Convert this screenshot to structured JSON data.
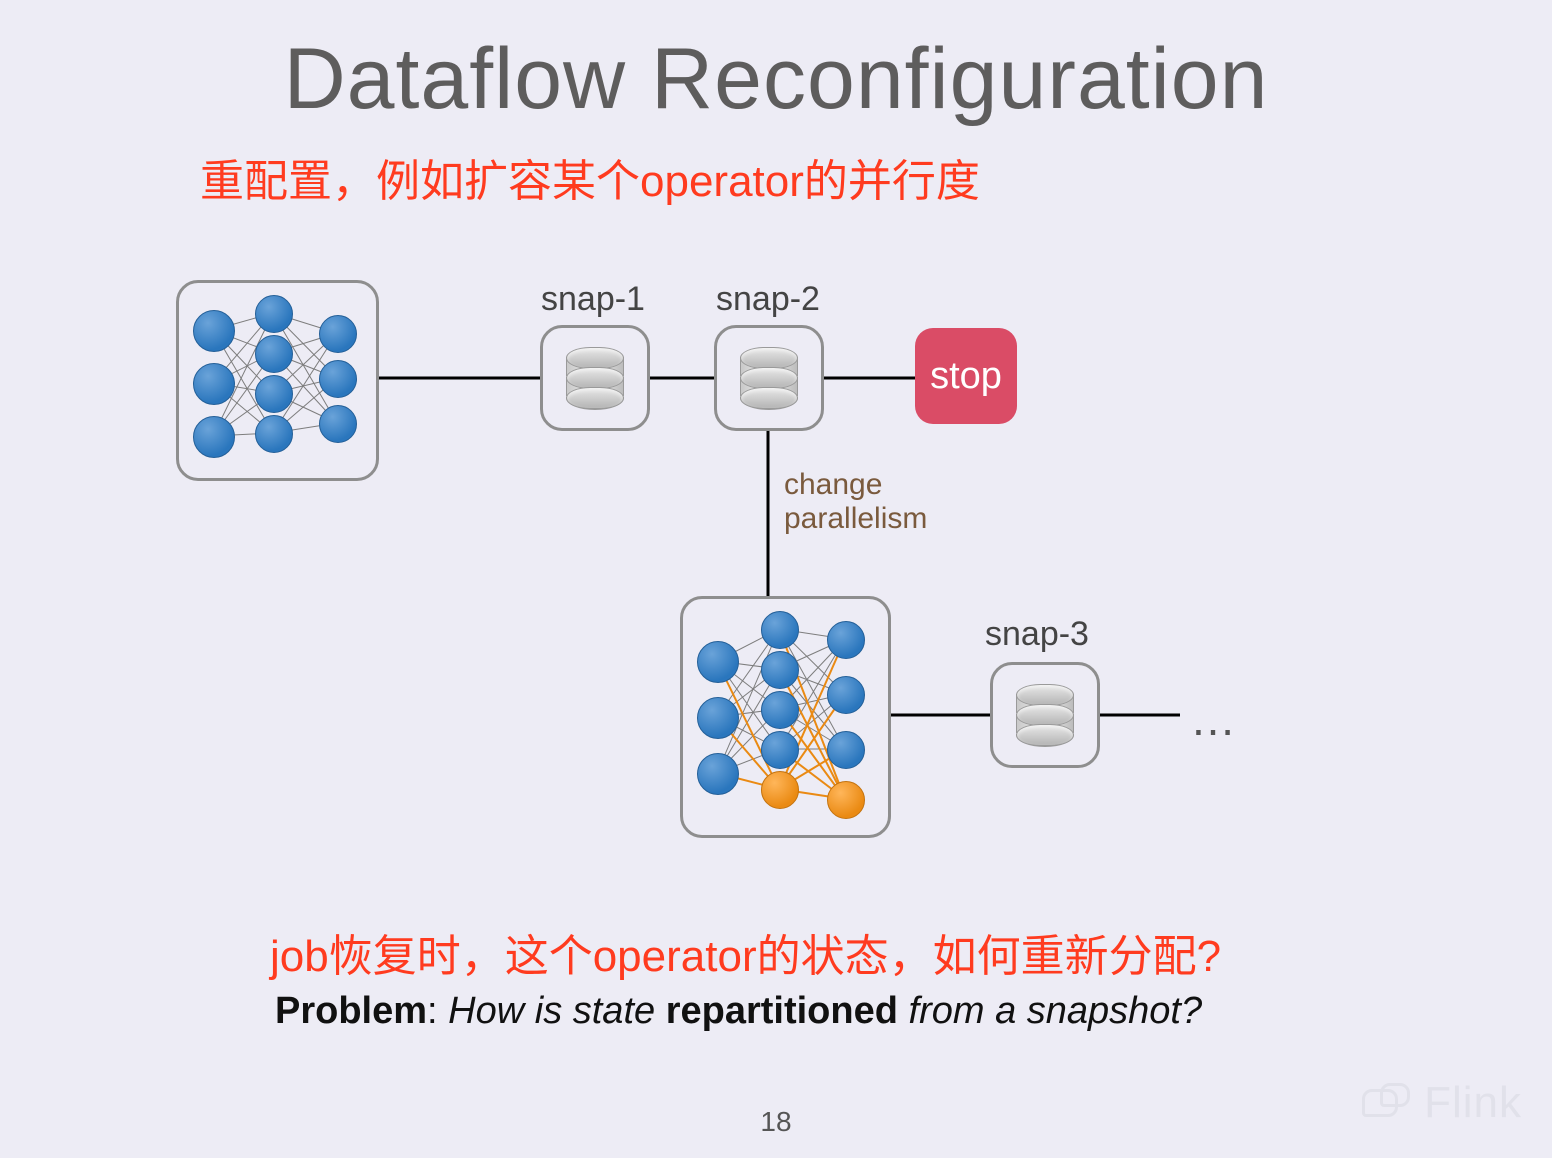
{
  "title": "Dataflow Reconfiguration",
  "subtitle": "重配置，例如扩容某个operator的并行度",
  "snap1": "snap-1",
  "snap2": "snap-2",
  "snap3": "snap-3",
  "stop": "stop",
  "change1": "change",
  "change2": "parallelism",
  "ellipsis": "…",
  "question_cn": "job恢复时，这个operator的状态，如何重新分配?",
  "problem_label": "Problem",
  "problem_before": ": ",
  "problem_i1": "How is state ",
  "problem_b": "repartitioned",
  "problem_i2": " from a snapshot?",
  "page": "18",
  "watermark": "Flink"
}
